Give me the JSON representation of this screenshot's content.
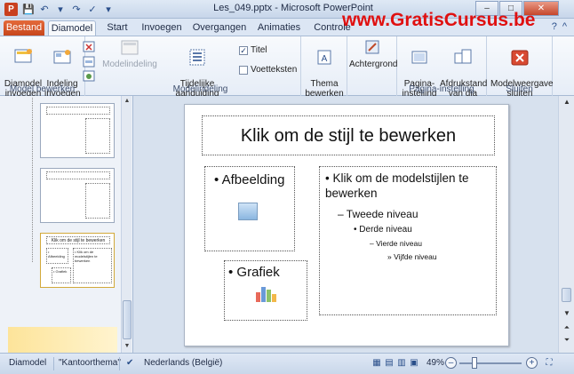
{
  "window": {
    "title": "Les_049.pptx - Microsoft PowerPoint",
    "watermark": "www.GratisCursus.be",
    "controls": {
      "minimize": "–",
      "maximize": "□",
      "close": "✕"
    }
  },
  "tabs": {
    "file": "Bestand",
    "items": [
      "Diamodel",
      "Start",
      "Invoegen",
      "Overgangen",
      "Animaties",
      "Controle"
    ],
    "active": "Diamodel"
  },
  "ribbon": {
    "groups": {
      "model_bewerken": {
        "label": "Model bewerken",
        "insert_master": "Diamodel\ninvoegen",
        "insert_layout": "Indeling\ninvoegen"
      },
      "modelindeling": {
        "label": "Modelindeling",
        "master_layout": "Modelindeling",
        "insert_placeholder": "Tijdelijke aanduiding\ninvoegen",
        "titel_checkbox": "Titel",
        "footers_checkbox": "Voetteksten",
        "titel_checked": true,
        "footers_checked": false
      },
      "thema": {
        "themes": "Thema\nbewerken",
        "background": "Achtergrond"
      },
      "pagina_instelling": {
        "label": "Pagina-instelling",
        "page_setup": "Pagina-\ninstelling",
        "orientation": "Afdrukstand\nvan dia"
      },
      "sluiten": {
        "label": "Sluiten",
        "close_master": "Modelweergave\nsluiten"
      }
    }
  },
  "thumbnails": {
    "selected_index": 2,
    "slide3_title": "Klik om de stijl te bewerken",
    "slide3_left": "• Afbeelding",
    "slide3_chart": "• Grafiek",
    "slide3_right": "• Klik om de modelstijlen te bewerken"
  },
  "slide": {
    "title": "Klik om de stijl te bewerken",
    "picture_bullet": "Afbeelding",
    "chart_bullet": "Grafiek",
    "body": {
      "level1": "Klik om de modelstijlen te bewerken",
      "level2": "Tweede niveau",
      "level3": "Derde niveau",
      "level4": "Vierde niveau",
      "level5": "Vijfde niveau"
    }
  },
  "statusbar": {
    "view": "Diamodel",
    "theme": "\"Kantoorthema\"",
    "language": "Nederlands (België)",
    "zoom": "49%"
  }
}
